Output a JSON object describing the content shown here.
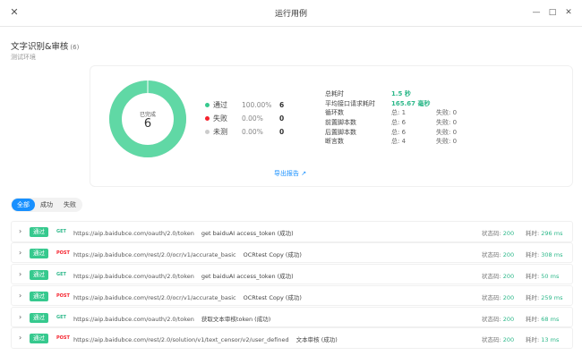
{
  "window": {
    "title": "运行用例",
    "controls": [
      "minimize-icon",
      "maximize-icon",
      "close-icon"
    ]
  },
  "suite": {
    "name": "文字识别&审核",
    "count": "(6)",
    "environment": "测试环境"
  },
  "donut": {
    "center_label": "已完成",
    "center_value": "6",
    "pass_fraction": 1.0,
    "pass_color": "#60d8a5",
    "fail_color": "#f5222d",
    "untested_color": "#d9d9d9"
  },
  "legend": [
    {
      "name": "通过",
      "percent": "100.00%",
      "count": "6",
      "color": "#36c98e"
    },
    {
      "name": "失败",
      "percent": "0.00%",
      "count": "0",
      "color": "#f5222d"
    },
    {
      "name": "未测",
      "percent": "0.00%",
      "count": "0",
      "color": "#cccccc"
    }
  ],
  "stats": {
    "total_time": {
      "label": "总耗时",
      "value": "1.5 秒"
    },
    "avg_time": {
      "label": "平均接口请求耗时",
      "value": "165.67 毫秒"
    },
    "loops": {
      "label": "循环数",
      "total": "总: 1",
      "fail": "失败: 0"
    },
    "pre_scripts": {
      "label": "前置脚本数",
      "total": "总: 6",
      "fail": "失败: 0"
    },
    "post_scripts": {
      "label": "后置脚本数",
      "total": "总: 6",
      "fail": "失败: 0"
    },
    "assertions": {
      "label": "断言数",
      "total": "总: 4",
      "fail": "失败: 0"
    }
  },
  "export_label": "导出报告",
  "filters": [
    {
      "label": "全部",
      "active": true
    },
    {
      "label": "成功",
      "active": false
    },
    {
      "label": "失败",
      "active": false
    }
  ],
  "requests": [
    {
      "badge": "通过",
      "method": "GET",
      "url": "https://aip.baidubce.com/oauth/2.0/token",
      "name": "get baiduAI access_token (成功)",
      "status_label": "状态码:",
      "status": "200",
      "time_label": "耗时:",
      "time": "296 ms"
    },
    {
      "badge": "通过",
      "method": "POST",
      "url": "https://aip.baidubce.com/rest/2.0/ocr/v1/accurate_basic",
      "name": "OCRtest Copy (成功)",
      "status_label": "状态码:",
      "status": "200",
      "time_label": "耗时:",
      "time": "308 ms"
    },
    {
      "badge": "通过",
      "method": "GET",
      "url": "https://aip.baidubce.com/oauth/2.0/token",
      "name": "get baiduAI access_token (成功)",
      "status_label": "状态码:",
      "status": "200",
      "time_label": "耗时:",
      "time": "50 ms"
    },
    {
      "badge": "通过",
      "method": "POST",
      "url": "https://aip.baidubce.com/rest/2.0/ocr/v1/accurate_basic",
      "name": "OCRtest Copy (成功)",
      "status_label": "状态码:",
      "status": "200",
      "time_label": "耗时:",
      "time": "259 ms"
    },
    {
      "badge": "通过",
      "method": "GET",
      "url": "https://aip.baidubce.com/oauth/2.0/token",
      "name": "获取文本审核token (成功)",
      "status_label": "状态码:",
      "status": "200",
      "time_label": "耗时:",
      "time": "68 ms"
    },
    {
      "badge": "通过",
      "method": "POST",
      "url": "https://aip.baidubce.com/rest/2.0/solution/v1/text_censor/v2/user_defined",
      "name": "文本审核 (成功)",
      "status_label": "状态码:",
      "status": "200",
      "time_label": "耗时:",
      "time": "13 ms"
    }
  ]
}
